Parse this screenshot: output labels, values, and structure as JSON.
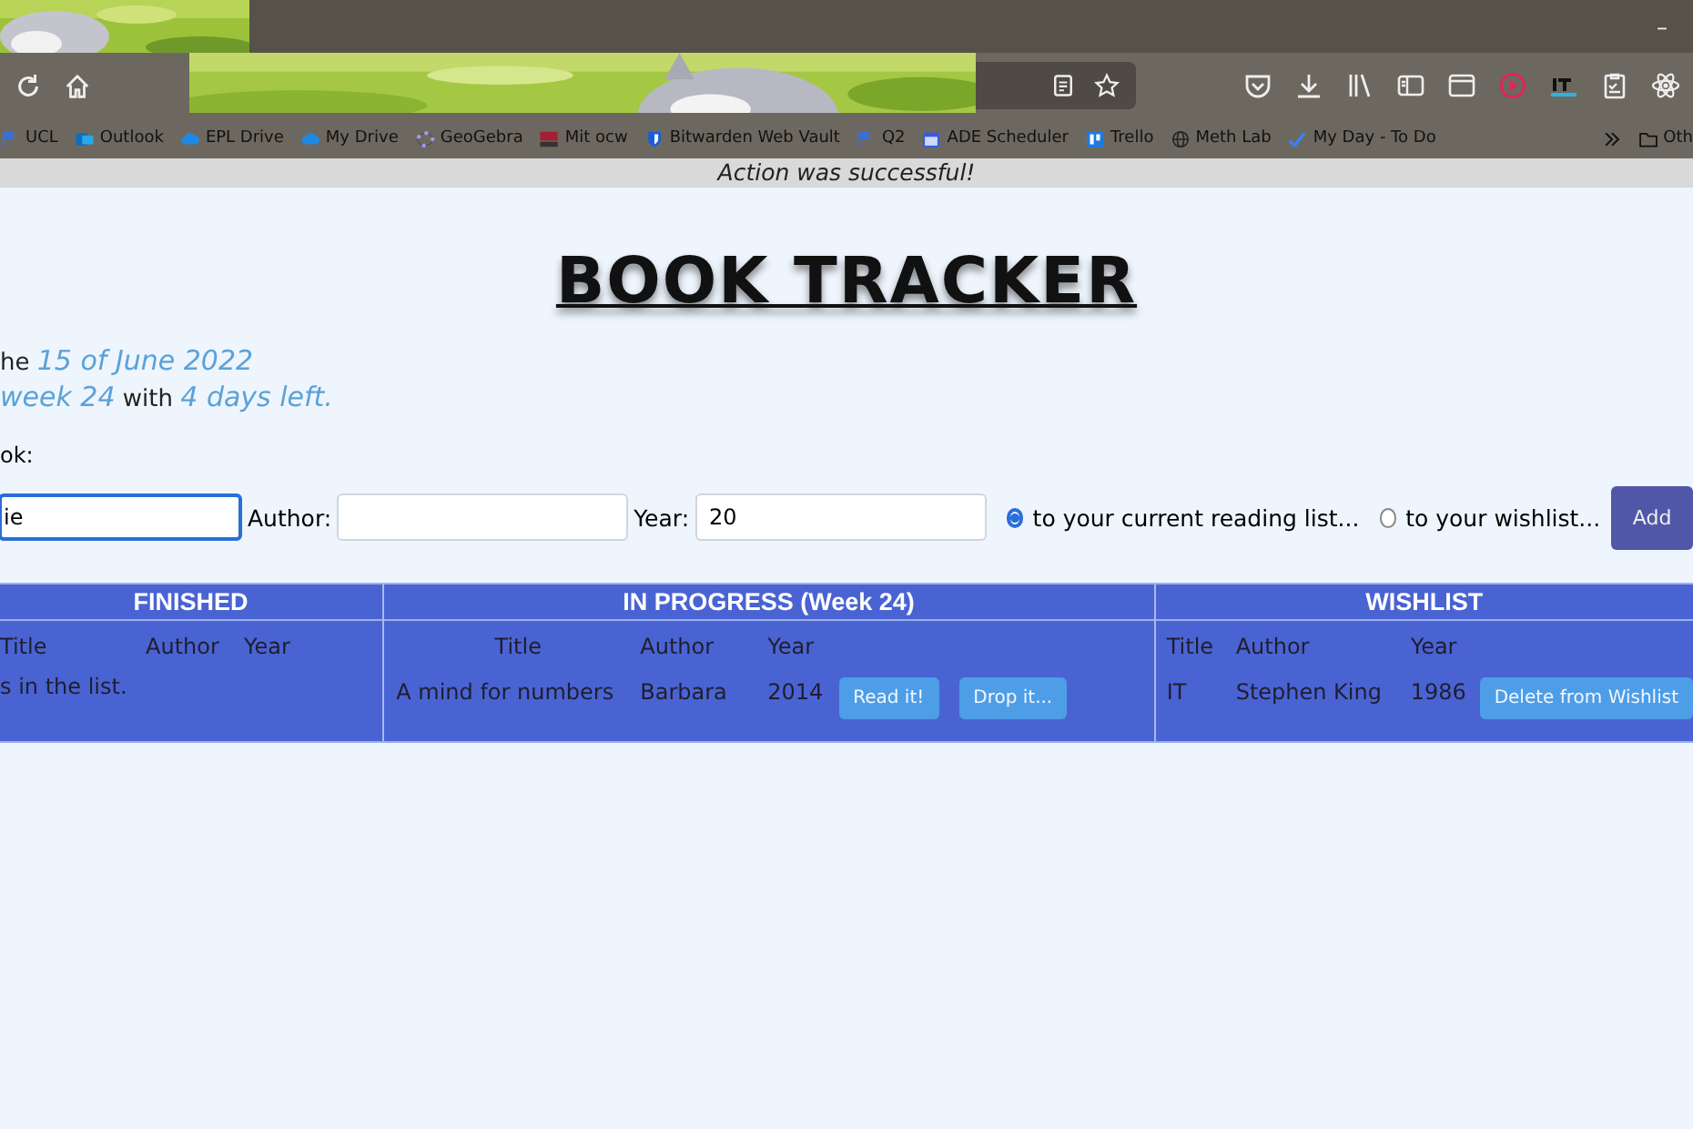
{
  "browser": {
    "bookmarks": [
      {
        "label": "UCL",
        "kind": "flag"
      },
      {
        "label": "Outlook",
        "kind": "mail"
      },
      {
        "label": "EPL Drive",
        "kind": "cloud"
      },
      {
        "label": "My Drive",
        "kind": "cloud"
      },
      {
        "label": "GeoGebra",
        "kind": "dots"
      },
      {
        "label": "Mit ocw",
        "kind": "logo"
      },
      {
        "label": "Bitwarden Web Vault",
        "kind": "shield"
      },
      {
        "label": "Q2",
        "kind": "flag"
      },
      {
        "label": "ADE Scheduler",
        "kind": "calendar"
      },
      {
        "label": "Trello",
        "kind": "board"
      },
      {
        "label": "Meth Lab",
        "kind": "globe"
      },
      {
        "label": "My Day - To Do",
        "kind": "check"
      }
    ],
    "other_bookmarks": "Oth",
    "minimize": "–"
  },
  "notification": "Action was successful!",
  "title": "BOOK TRACKER",
  "intro": [
    "he *15 of June 2022*",
    "*week 24* with *4 days left.*"
  ],
  "form": {
    "label": "ok:",
    "fields": [
      {
        "value": "ie",
        "focused": true
      },
      {
        "label": "Author:",
        "focused": false
      },
      {
        "label": "Year:",
        "value": "20",
        "focused": false
      }
    ],
    "targets": [
      {
        "label": "to your current reading list...",
        "selected": true
      },
      {
        "label": "to your wishlist...",
        "selected": false
      }
    ],
    "button": "Add"
  },
  "sections": [
    {
      "kind": "finished",
      "heading": "FINISHED",
      "columns": [
        "Title",
        "Author",
        "Year"
      ],
      "message": "s in the list."
    },
    {
      "kind": "progress",
      "heading": "IN PROGRESS (Week 24)",
      "columns": [
        "Title",
        "Author",
        "Year"
      ],
      "rows": [
        {
          "cells": [
            "A mind for numbers",
            "Barbara",
            "2014"
          ],
          "actions": [
            "Read it!",
            "Drop it..."
          ]
        }
      ]
    },
    {
      "kind": "wishlist",
      "heading": "WISHLIST",
      "columns": [
        "Title",
        "Author",
        "Year"
      ],
      "rows": [
        {
          "cells": [
            "IT",
            "Stephen King",
            "1986"
          ],
          "actions": [
            "Delete from Wishlist"
          ]
        }
      ]
    }
  ]
}
